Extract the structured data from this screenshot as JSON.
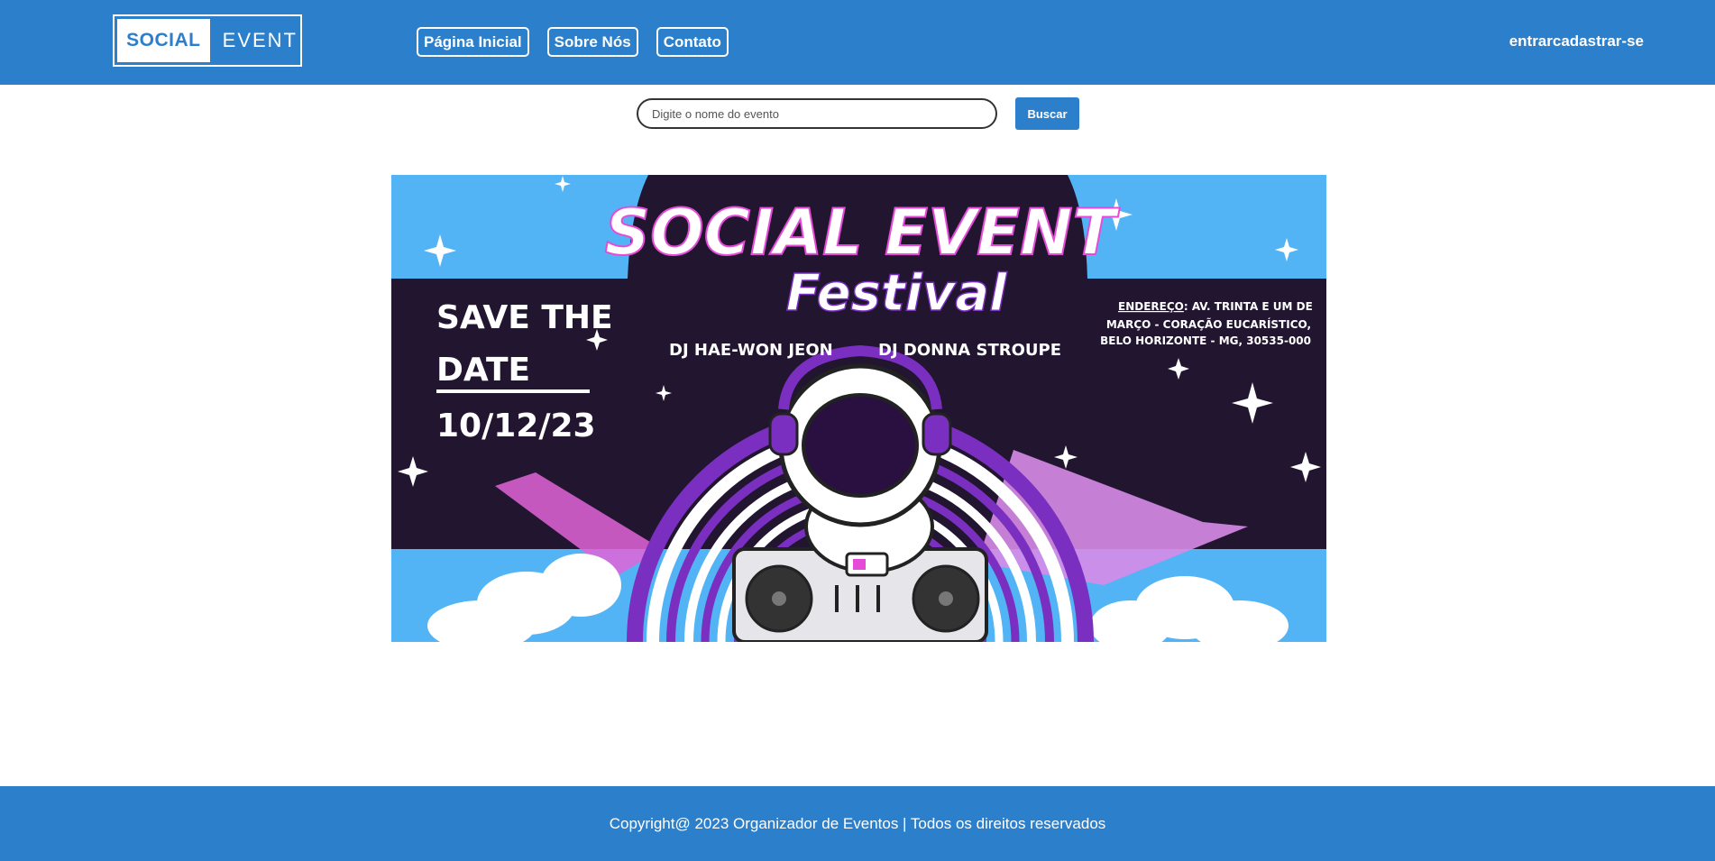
{
  "header": {
    "logo": {
      "word1": "SOCIAL",
      "word2": "EVENT"
    },
    "nav": [
      {
        "label": "Página Inicial"
      },
      {
        "label": "Sobre Nós"
      },
      {
        "label": "Contato"
      }
    ],
    "auth": {
      "login": "entrar",
      "register": "cadastrar-se"
    }
  },
  "search": {
    "placeholder": "Digite o nome do evento",
    "value": "",
    "button_label": "Buscar"
  },
  "banner": {
    "title_line1": "SOCIAL EVENT",
    "title_line2": "Festival",
    "save_line1": "SAVE THE",
    "save_line2": "DATE",
    "date": "10/12/23",
    "dj1": "DJ HAE-WON JEON",
    "dj2": "DJ DONNA STROUPE",
    "address_label": "ENDEREÇO",
    "address_line1": ": AV. TRINTA E UM DE",
    "address_line2": "MARÇO - CORAÇÃO EUCARÍSTICO,",
    "address_line3": "BELO HORIZONTE - MG, 30535-000"
  },
  "footer": {
    "copyright": "Copyright@ 2023 Organizador de Eventos | Todos os direitos reservados"
  },
  "colors": {
    "brand_blue": "#2c7fcb",
    "banner_sky": "#52b4f5",
    "banner_night": "#221530",
    "banner_purple": "#7a2fc0",
    "banner_pink": "#e64bd8"
  }
}
